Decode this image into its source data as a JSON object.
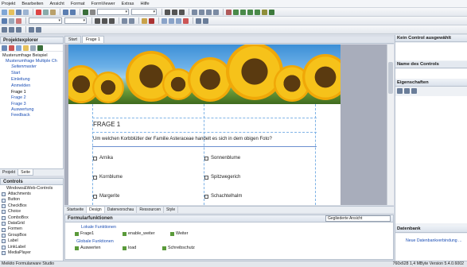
{
  "menu": [
    "Projekt",
    "Bearbeiten",
    "Ansicht",
    "Format",
    "FormViewer",
    "Extras",
    "Hilfe"
  ],
  "project_explorer": {
    "title": "Projektexplorer",
    "tree": [
      {
        "label": "Musterumfrage Beispiel",
        "level": 0
      },
      {
        "label": "Musterumfrage Multiple Ch",
        "level": 1
      },
      {
        "label": "Seitenmaster",
        "level": 2
      },
      {
        "label": "Start",
        "level": 2
      },
      {
        "label": "Einleitung",
        "level": 2
      },
      {
        "label": "Anmelden",
        "level": 2
      },
      {
        "label": "Frage 1",
        "level": 2
      },
      {
        "label": "Frage 2",
        "level": 2
      },
      {
        "label": "Frage 3",
        "level": 2
      },
      {
        "label": "Auswertung",
        "level": 2
      },
      {
        "label": "Feedback",
        "level": 2
      }
    ],
    "tabs": [
      "Projekt",
      "Seite"
    ]
  },
  "controls": {
    "title": "Controls",
    "group": "Windows&Web-Controls",
    "items": [
      "Attachments",
      "Button",
      "CheckBox",
      "Choice",
      "ComboBox",
      "DataGrid",
      "Formen",
      "GroupBox",
      "Label",
      "LinkLabel",
      "MediaPlayer"
    ]
  },
  "doc_tabs": [
    "Start",
    "Frage 1"
  ],
  "page": {
    "title": "FRAGE 1",
    "question": "Um welchen Korbblütler der Familie Asteraceae handelt es sich in dem obigen Foto?",
    "options_left": [
      "Arnika",
      "Kornblume",
      "Margerite"
    ],
    "options_right": [
      "Sonnenblume",
      "Spitzwegerich",
      "Schachtelhalm"
    ]
  },
  "bottom_tabs": [
    "Startseite",
    "Design",
    "Datenvorschau",
    "Ressourcen",
    "Style"
  ],
  "formular": {
    "title": "Formularfunktionen",
    "view_select": "Gegliederte Ansicht",
    "local_section": "Lokale Funktionen",
    "local_items": [
      "Frage1",
      "enable_weiter",
      "Weiter"
    ],
    "global_section": "Globale Funktionen",
    "global_items": [
      "Auswerten",
      "load",
      "Schreibschutz"
    ]
  },
  "right_panel": {
    "no_control": "Kein Control ausgewählt",
    "control_name": "Name des Controls",
    "properties": "Eigenschaften",
    "database": "Datenbank",
    "new_db": "Neue Datenbankverbindung ..."
  },
  "status": {
    "left": "Meikito Formularware Studio",
    "right": "760x628   1,4 MByte   Version 5.4.0.6002"
  },
  "colors": {
    "accent": "#1c4fb5",
    "panel": "#eef1f5",
    "canvas": "#a8adbb"
  }
}
